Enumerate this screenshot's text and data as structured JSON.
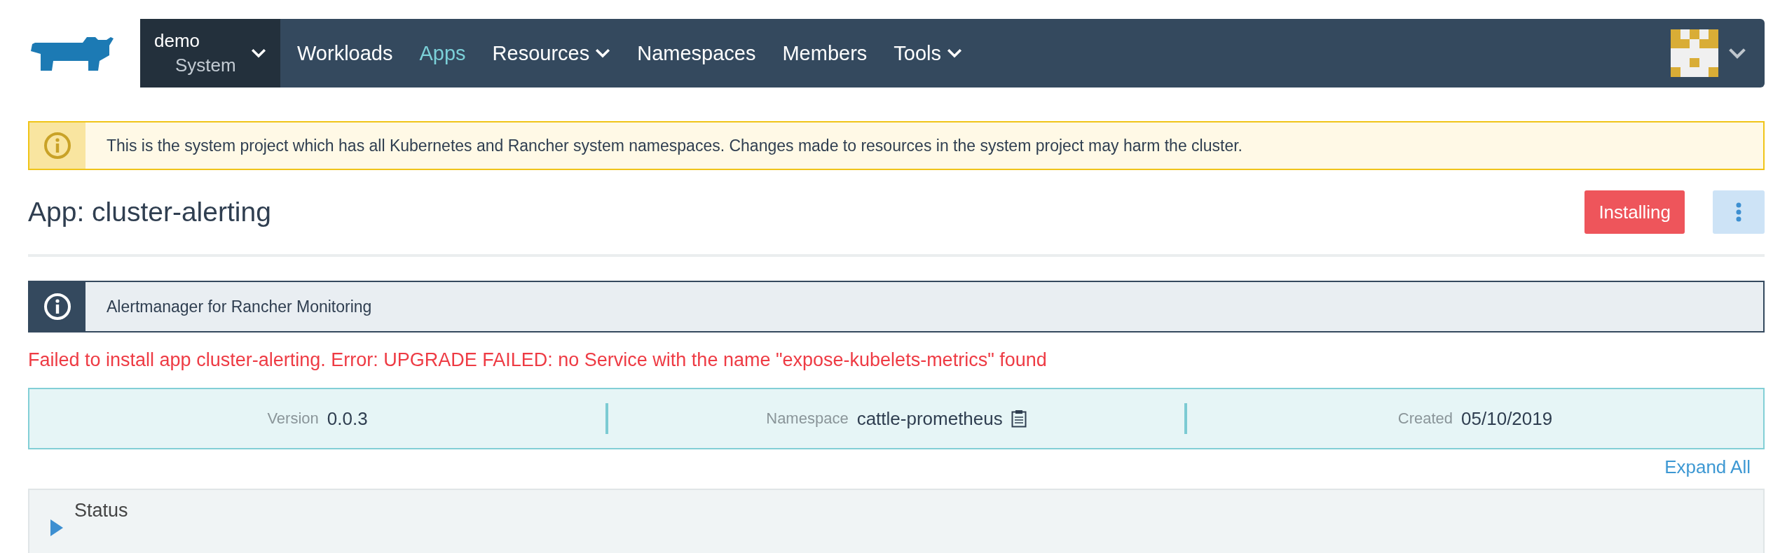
{
  "project_switcher": {
    "cluster": "demo",
    "project": "System"
  },
  "nav": [
    {
      "label": "Workloads",
      "selected": false,
      "has_menu": false
    },
    {
      "label": "Apps",
      "selected": true,
      "has_menu": false
    },
    {
      "label": "Resources",
      "selected": false,
      "has_menu": true
    },
    {
      "label": "Namespaces",
      "selected": false,
      "has_menu": false
    },
    {
      "label": "Members",
      "selected": false,
      "has_menu": false
    },
    {
      "label": "Tools",
      "selected": false,
      "has_menu": true
    }
  ],
  "system_banner": {
    "text": "This is the system project which has all Kubernetes and Rancher system namespaces. Changes made to resources in the system project may harm the cluster."
  },
  "header": {
    "title": "App: cluster-alerting",
    "state": "Installing"
  },
  "description": {
    "text": "Alertmanager for Rancher Monitoring"
  },
  "error": "Failed to install app cluster-alerting. Error: UPGRADE FAILED: no Service with the name \"expose-kubelets-metrics\" found",
  "facts": [
    {
      "label": "Version",
      "value": "0.0.3",
      "copy": false
    },
    {
      "label": "Namespace",
      "value": "cattle-prometheus",
      "copy": true
    },
    {
      "label": "Created",
      "value": "05/10/2019",
      "copy": false
    }
  ],
  "expand_all": "Expand All",
  "sections": [
    {
      "title": "Status",
      "expanded": false
    }
  ]
}
